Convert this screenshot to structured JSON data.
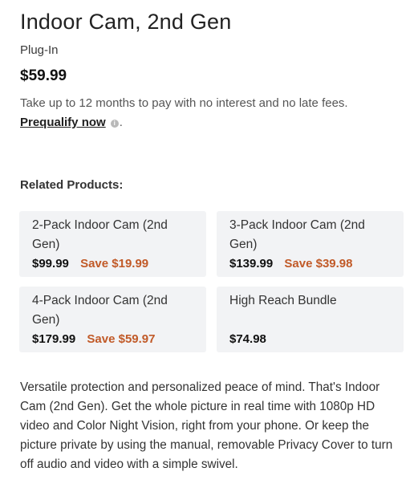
{
  "product": {
    "title": "Indoor Cam, 2nd Gen",
    "variant": "Plug-In",
    "price": "$59.99"
  },
  "financing": {
    "text": "Take up to 12 months to pay with no interest and no late fees.",
    "link_label": "Prequalify now",
    "info_icon": "info-icon",
    "trailing": "."
  },
  "related": {
    "heading": "Related Products:",
    "items": [
      {
        "name": "2-Pack Indoor Cam (2nd Gen)",
        "price": "$99.99",
        "save": "Save $19.99"
      },
      {
        "name": "3-Pack Indoor Cam (2nd Gen)",
        "price": "$139.99",
        "save": "Save $39.98"
      },
      {
        "name": "4-Pack Indoor Cam (2nd Gen)",
        "price": "$179.99",
        "save": "Save $59.97"
      },
      {
        "name": "High Reach Bundle",
        "price": "$74.98",
        "save": ""
      }
    ]
  },
  "description": "Versatile protection and personalized peace of mind. That's Indoor Cam (2nd Gen). Get the whole picture in real time with 1080p HD video and Color Night Vision, right from your phone. Or keep the picture private by using the manual, removable Privacy Cover to turn off audio and video with a simple swivel.",
  "colors": {
    "save_accent": "#c15a28",
    "card_background": "#f2f3f5"
  }
}
